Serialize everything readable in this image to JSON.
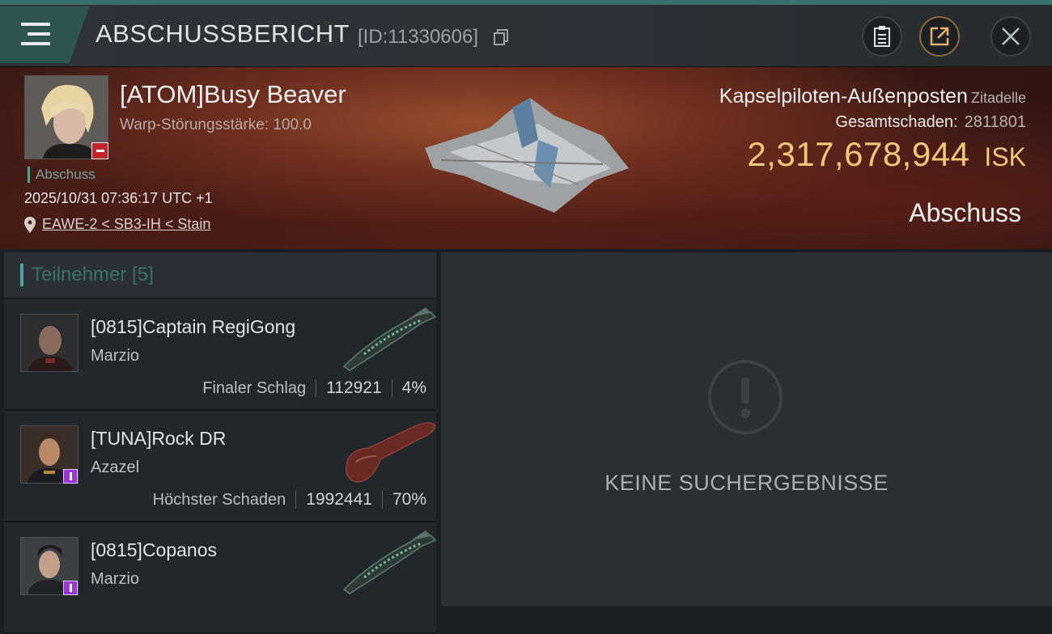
{
  "header": {
    "title": "ABSCHUSSBERICHT",
    "report_id": "[ID:11330606]",
    "icons": [
      "menu-icon",
      "copy-icon",
      "clipboard-icon",
      "share-icon",
      "close-icon"
    ]
  },
  "victim": {
    "name": "[ATOM]Busy Beaver",
    "warp_label": "Warp-Störungsstärke: 100.0",
    "kill_tag": "Abschuss",
    "datetime": "2025/10/31 07:36:17 UTC +1",
    "location": "EAWE-2 < SB3-IH < Stain",
    "ship_name": "Kapselpiloten-Außenposten",
    "ship_class": "Zitadelle",
    "damage_label": "Gesamtschaden:",
    "damage_value": "2811801",
    "isk_value": "2,317,678,944",
    "isk_unit": "ISK",
    "result": "Abschuss"
  },
  "participants": {
    "tab_label": "Teilnehmer [5]",
    "rows": [
      {
        "name": "[0815]Captain RegiGong",
        "ship": "Marzio",
        "role": "Finaler Schlag",
        "damage": "112921",
        "percent": "4%",
        "badge": false
      },
      {
        "name": "[TUNA]Rock DR",
        "ship": "Azazel",
        "role": "Höchster Schaden",
        "damage": "1992441",
        "percent": "70%",
        "badge": true
      },
      {
        "name": "[0815]Copanos",
        "ship": "Marzio",
        "role": "",
        "damage": "",
        "percent": "",
        "badge": true
      }
    ]
  },
  "detail": {
    "empty_text": "KEINE SUCHERGEBNISSE"
  },
  "colors": {
    "accent": "#4aa69a",
    "isk": "#f1c879",
    "badge_red": "#c1242a",
    "badge_purple": "#9b35d6"
  }
}
